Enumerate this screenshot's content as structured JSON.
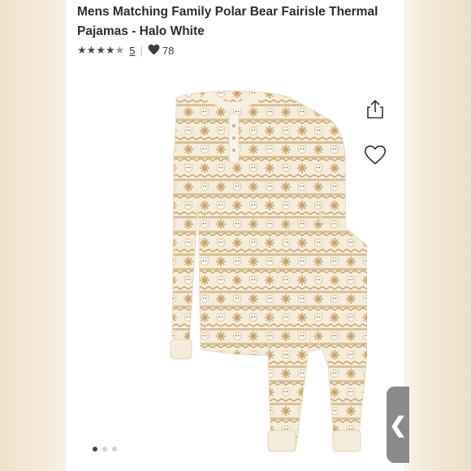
{
  "product": {
    "title": "Mens Matching Family Polar Bear Fairisle Thermal Pajamas - Halo White",
    "rating": 4.5,
    "review_count": "5",
    "likes": "78"
  },
  "icons": {
    "share": "share-icon",
    "favorite": "heart-outline-icon",
    "likes": "heart-filled-icon",
    "side_tab": "chevron-left-icon"
  },
  "gallery": {
    "total": 3,
    "active_index": 0,
    "side_tab_glyph": "❮"
  },
  "colors": {
    "pattern_gold": "#c9a46a",
    "pattern_tan": "#d9c29c",
    "fabric_cream": "#f5ecdb",
    "text_dark": "#2d2d2d"
  }
}
